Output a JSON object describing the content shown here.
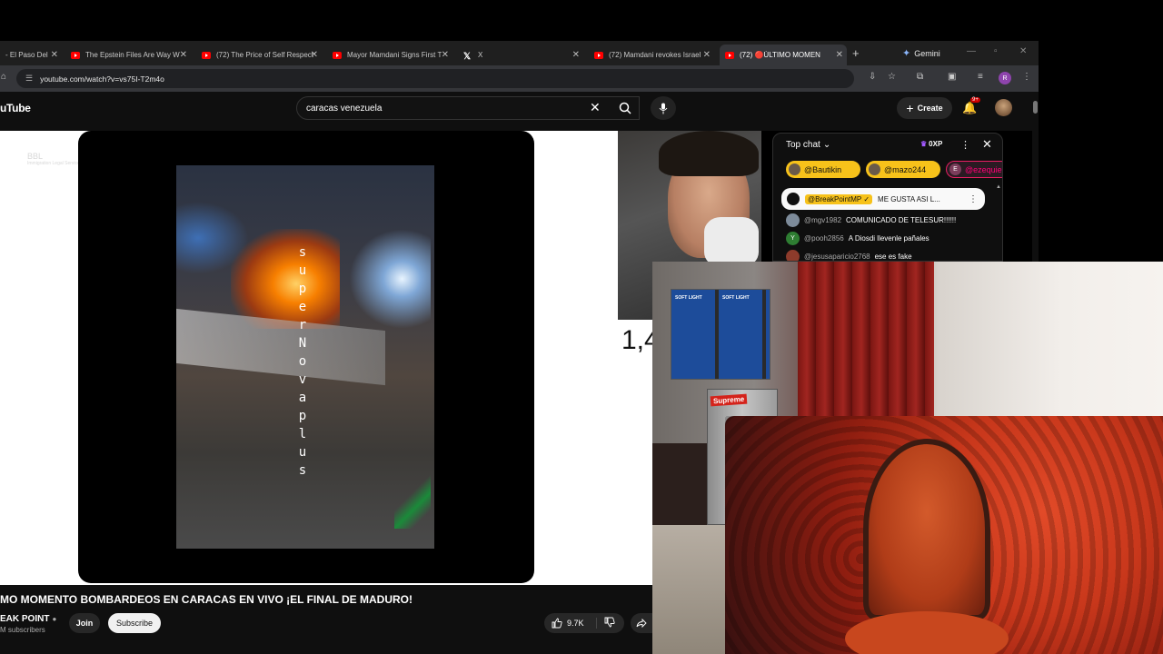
{
  "browser": {
    "tabs": [
      {
        "title": "- El Paso Del",
        "type": "yt"
      },
      {
        "title": "The Epstein Files Are Way W",
        "type": "yt"
      },
      {
        "title": "(72) The Price of Self Respect",
        "type": "yt"
      },
      {
        "title": "Mayor Mamdani Signs First T",
        "type": "yt"
      },
      {
        "title": "X",
        "type": "x"
      },
      {
        "title": "(72) Mamdani revokes Israel",
        "type": "yt"
      },
      {
        "title": "(72) 🔴ÚLTIMO MOMEN",
        "type": "yt",
        "active": true
      }
    ],
    "gemini_label": "Gemini",
    "url": "youtube.com/watch?v=vs75I-T2m4o",
    "profile_initial": "R"
  },
  "youtube": {
    "logo": "uTube",
    "search_query": "caracas venezuela",
    "create_label": "Create",
    "notification_count": "9+"
  },
  "video": {
    "overlay_text": "superNova plus",
    "watermark": "BBL",
    "watermark_sub": "Immigration Legal Services",
    "title": "MO MOMENTO BOMBARDEOS EN CARACAS EN VIVO ¡EL FINAL DE MADURO!",
    "channel": "EAK POINT",
    "subscribers": "M subscribers",
    "join_label": "Join",
    "subscribe_label": "Subscribe",
    "likes": "9.7K",
    "viewer_count_partial": "1,4"
  },
  "chat": {
    "header": "Top chat",
    "xp": "0XP",
    "chips": [
      {
        "name": "@Bautikin"
      },
      {
        "name": "@mazo244"
      },
      {
        "name": "@ezequiel",
        "initial": "E"
      }
    ],
    "pinned": {
      "author": "@BreakPointMP ✓",
      "text": "ME GUSTA ASI L..."
    },
    "messages": [
      {
        "initial": "",
        "user": "@mgv1982",
        "text": "COMUNICADO DE TELESUR!!!!!!"
      },
      {
        "initial": "Y",
        "user": "@pooh2856",
        "text": "A Diosdi llevenle pañales"
      },
      {
        "initial": "",
        "user": "@jesusaparicio2768",
        "text": "ese es fake"
      }
    ]
  },
  "room_cam": {
    "boxes_label": "SOFT LIGHT",
    "supreme_label": "Supreme"
  },
  "colors": {
    "youtube_red": "#ff0000",
    "chip_yellow": "#f7c21a",
    "page_bg": "#0f0f0f"
  }
}
